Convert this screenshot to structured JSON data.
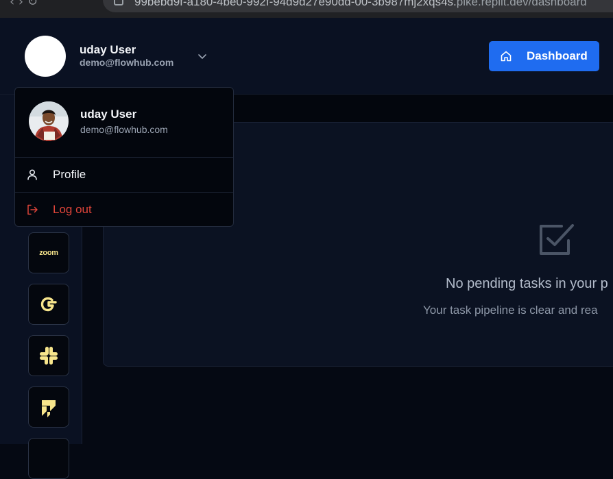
{
  "browser": {
    "address_path_prefix": "99bebd9f-a180-4be0-992f-94d9d27e90dd-00-3b987mj2xqs4s.",
    "address_host": "pike.replit.dev",
    "address_path": "/dashboard",
    "nav_glyphs": "‹   ›   ↻"
  },
  "header": {
    "user_name": "uday User",
    "user_email": "demo@flowhub.com",
    "dashboard_button_label": "Dashboard"
  },
  "dropdown": {
    "user_name": "uday User",
    "user_email": "demo@flowhub.com",
    "items": [
      {
        "label": "Profile",
        "icon": "user-icon"
      },
      {
        "label": "Log out",
        "icon": "logout-icon"
      }
    ]
  },
  "sidebar": {
    "apps": [
      {
        "name": "zoom",
        "label": "zoom",
        "icon": "zoom-icon"
      },
      {
        "name": "google",
        "label": "",
        "icon": "google-icon"
      },
      {
        "name": "slack",
        "label": "",
        "icon": "slack-icon"
      },
      {
        "name": "jira",
        "label": "",
        "icon": "jira-icon"
      }
    ]
  },
  "main": {
    "empty_title": "No pending tasks in your p",
    "empty_subtitle": "Your task pipeline is clear and rea"
  },
  "colors": {
    "accent": "#1f6cf0",
    "danger": "#e0453a",
    "icon_yellow": "#f7e58c",
    "background": "#050913",
    "panel": "#0b1222"
  }
}
